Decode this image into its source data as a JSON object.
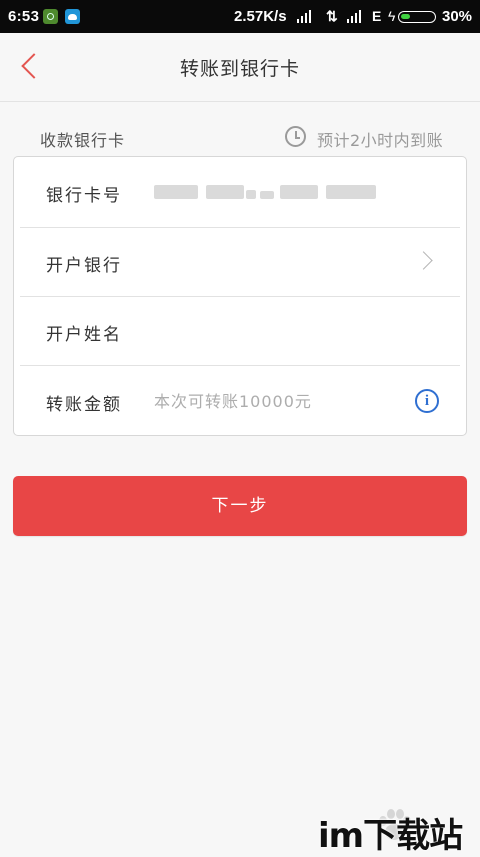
{
  "status_bar": {
    "time": "6:53",
    "net_speed": "2.57K/s",
    "network_arrows": "⇅",
    "network_type": "E",
    "battery_percent": "30%",
    "battery_level": 0.3,
    "notification_icons": [
      "android-notification-icon",
      "app-notification-icon"
    ]
  },
  "header": {
    "title": "转账到银行卡",
    "back_icon": "chevron-left-icon"
  },
  "section": {
    "title": "收款银行卡",
    "eta_icon": "clock-icon",
    "eta": "预计2小时内到账"
  },
  "form": {
    "card_number_label": "银行卡号",
    "bank_label": "开户银行",
    "name_label": "开户姓名",
    "amount_label": "转账金额",
    "amount_placeholder": "本次可转账10000元",
    "info_icon": "info-icon"
  },
  "actions": {
    "next_label": "下一步"
  },
  "watermark": {
    "text": "im下载站"
  },
  "colors": {
    "accent_red": "#e84646",
    "back_arrow": "#e35550",
    "info_blue": "#2f6fd1",
    "background": "#f7f7f7"
  }
}
